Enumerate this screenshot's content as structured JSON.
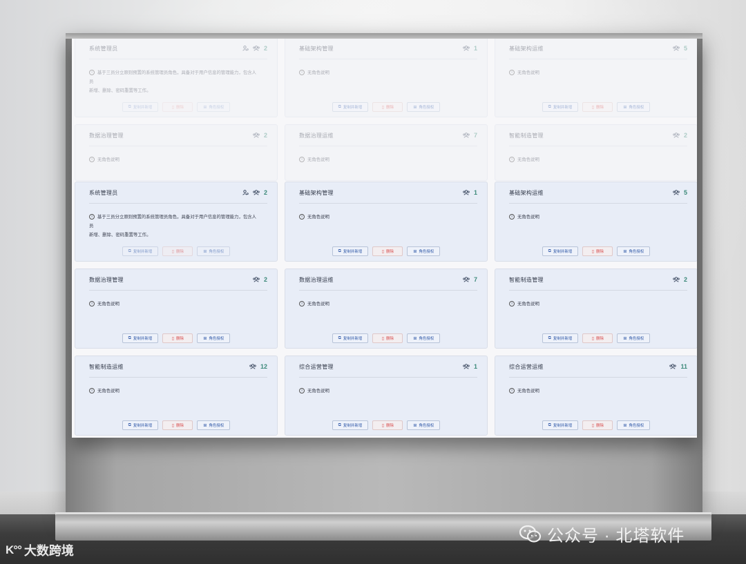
{
  "cards": [
    {
      "title": "系统管理员",
      "has_user_icon": true,
      "count": "2",
      "desc": "基于三员分立原则预置的系统管理员角色，具备对于用户信息的管理能力，包含人员新增、删除、密码重置等工作。",
      "desc_line2": "新增、删除、密码重置等工作。",
      "buttons_disabled": true
    },
    {
      "title": "基础架构管理",
      "has_user_icon": false,
      "count": "1",
      "desc": "无角色说明",
      "buttons_disabled": false
    },
    {
      "title": "基础架构运维",
      "has_user_icon": false,
      "count": "5",
      "desc": "无角色说明",
      "buttons_disabled": false
    },
    {
      "title": "数据治理管理",
      "has_user_icon": false,
      "count": "2",
      "desc": "无角色说明",
      "buttons_disabled": false
    },
    {
      "title": "数据治理运维",
      "has_user_icon": false,
      "count": "7",
      "desc": "无角色说明",
      "buttons_disabled": false
    },
    {
      "title": "智能制造管理",
      "has_user_icon": false,
      "count": "2",
      "desc": "无角色说明",
      "buttons_disabled": false
    },
    {
      "title": "智能制造运维",
      "has_user_icon": false,
      "count": "12",
      "desc": "无角色说明",
      "buttons_disabled": false
    },
    {
      "title": "综合运营管理",
      "has_user_icon": false,
      "count": "1",
      "desc": "无角色说明",
      "buttons_disabled": false
    },
    {
      "title": "综合运营运维",
      "has_user_icon": false,
      "count": "11",
      "desc": "无角色说明",
      "buttons_disabled": false
    }
  ],
  "card_desc_first_line_admin": "基于三员分立原则预置的系统管理员角色，具备对于用户信息的管理能力，包含人员",
  "card_desc_second_line_admin": "新增、删除、密码重置等工作。",
  "buttons": {
    "copy": "复制并新增",
    "delete": "删除",
    "auth": "角色授权"
  },
  "watermark_left": "大数跨境",
  "watermark_right": "公众号 · 北塔软件",
  "colors": {
    "count": "#3d8a7a",
    "primary_btn": "#2f58a8",
    "danger_btn": "#d84b4b",
    "card_bg": "#e8edf7"
  }
}
